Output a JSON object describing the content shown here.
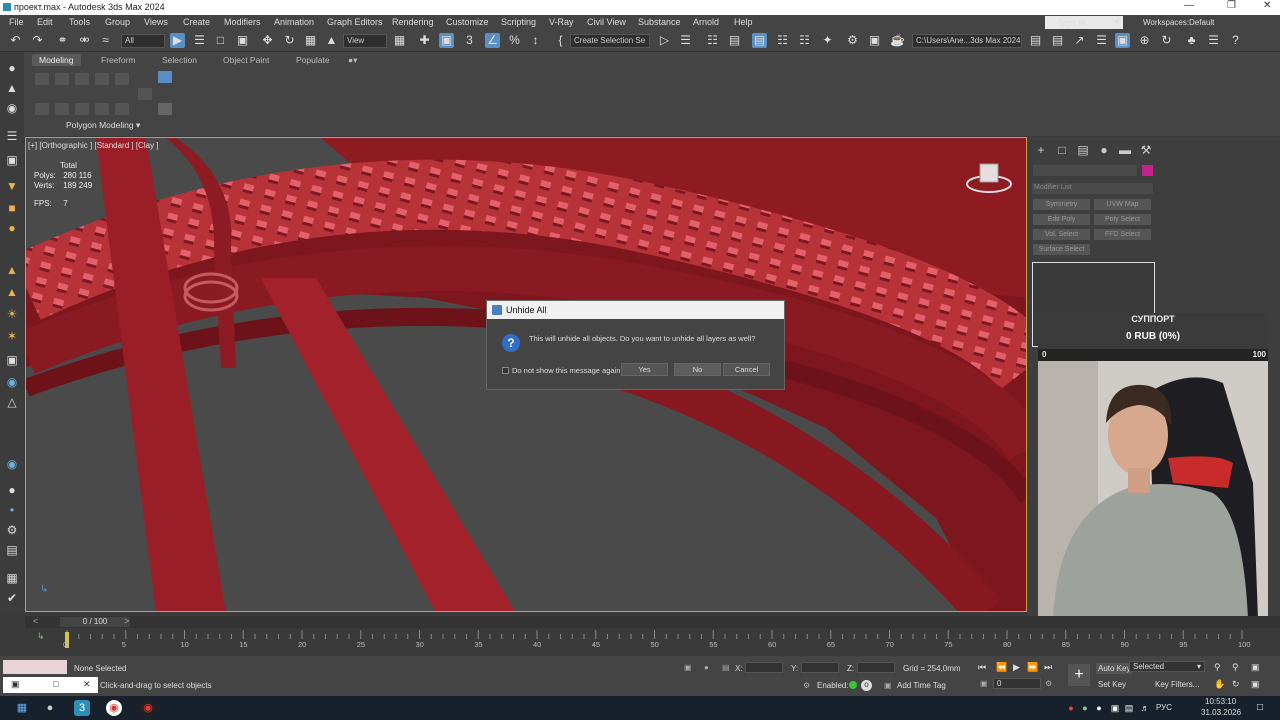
{
  "window": {
    "title": "проект.max - Autodesk 3ds Max 2024"
  },
  "menu": [
    "File",
    "Edit",
    "Tools",
    "Group",
    "Views",
    "Create",
    "Modifiers",
    "Animation",
    "Graph Editors",
    "Rendering",
    "Customize",
    "Scripting",
    "V-Ray",
    "Civil View",
    "Substance",
    "Arnold",
    "Help"
  ],
  "account": {
    "signin": "Sign In",
    "workspaces_label": "Workspaces:",
    "workspace": "Default"
  },
  "toolbar": {
    "filter": "All",
    "coord": "View",
    "selset": "Create Selection Se",
    "path": "C:\\Users\\Ane...3ds Max 2024"
  },
  "ribbon": {
    "tabs": [
      "Modeling",
      "Freeform",
      "Selection",
      "Object Paint",
      "Populate"
    ],
    "panel_label": "Polygon Modeling"
  },
  "viewport": {
    "label": "[+] [Orthographic ] [Standard ] [Clay ]",
    "stats_header": "Total",
    "polys_label": "Polys:",
    "polys": "280 116",
    "verts_label": "Verts:",
    "verts": "189 249",
    "fps_label": "FPS:",
    "fps": "7"
  },
  "dialog": {
    "title": "Unhide All",
    "message": "This will unhide all objects. Do you want to unhide all layers as well?",
    "checkbox": "Do not show this message again",
    "yes": "Yes",
    "no": "No",
    "cancel": "Cancel"
  },
  "command_panel": {
    "modifier_list": "Modifier List",
    "buttons": [
      "Symmetry",
      "UVW Map",
      "Edit Poly",
      "Poly Select",
      "Vol. Select",
      "FFD Select",
      "Surface Select"
    ]
  },
  "overlay": {
    "title": "СУППОРТ",
    "amount": "0 RUB (0%)",
    "min": "0",
    "max": "100",
    "progress": 0
  },
  "timeline": {
    "frame": "0 / 100",
    "ticks": [
      "0",
      "5",
      "10",
      "15",
      "20",
      "25",
      "30",
      "35",
      "40",
      "45",
      "50",
      "55",
      "60",
      "65",
      "70",
      "75",
      "80",
      "85",
      "90",
      "95",
      "100"
    ]
  },
  "statusbar": {
    "selection": "None Selected",
    "prompt": "Click-and-drag to select objects",
    "x_label": "X:",
    "y_label": "Y:",
    "z_label": "Z:",
    "grid": "Grid = 254,0mm",
    "enabled": "Enabled:",
    "add_time_tag": "Add Time Tag",
    "auto_key": "Auto Key",
    "set_key": "Set Key",
    "key_mode": "Selected",
    "key_filters": "Key Filters...",
    "frame": "0"
  },
  "taskbar": {
    "lang": "РУС",
    "time": "10:53:10",
    "date": "31.03.2026"
  },
  "colors": {
    "accent": "#5a8fc5",
    "viewport_border": "#c7a14a",
    "model": "#9e1c24",
    "dialog_icon": "#2f6fc8"
  }
}
